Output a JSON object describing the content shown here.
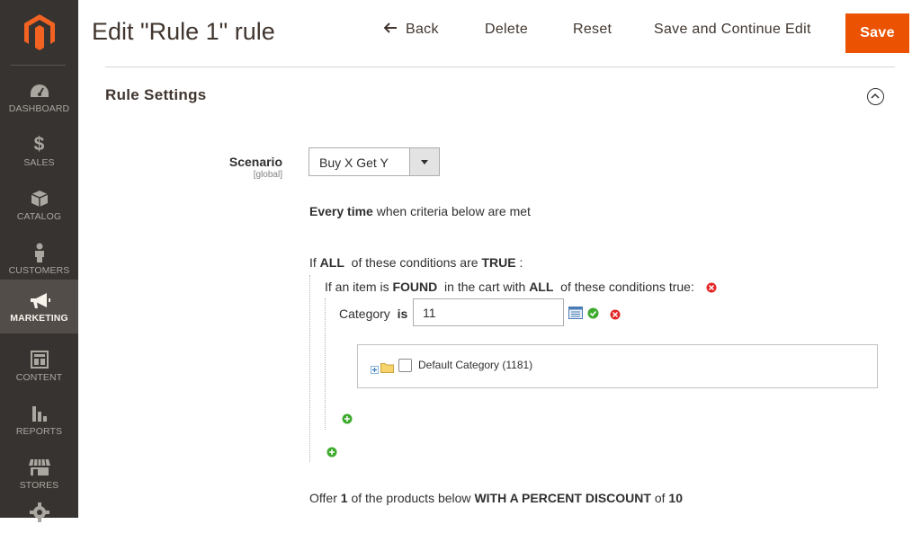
{
  "sidebar": {
    "items": [
      {
        "label": "DASHBOARD",
        "icon": "dashboard-icon"
      },
      {
        "label": "SALES",
        "icon": "dollar-icon"
      },
      {
        "label": "CATALOG",
        "icon": "cube-icon"
      },
      {
        "label": "CUSTOMERS",
        "icon": "person-icon"
      },
      {
        "label": "MARKETING",
        "icon": "megaphone-icon",
        "active": true
      },
      {
        "label": "CONTENT",
        "icon": "layout-icon"
      },
      {
        "label": "REPORTS",
        "icon": "bar-chart-icon"
      },
      {
        "label": "STORES",
        "icon": "store-icon"
      },
      {
        "label": "",
        "icon": "gear-icon"
      }
    ]
  },
  "header": {
    "title": "Edit \"Rule 1\" rule",
    "back_label": "Back",
    "delete_label": "Delete",
    "reset_label": "Reset",
    "save_continue_label": "Save and Continue Edit",
    "save_label": "Save"
  },
  "section": {
    "title": "Rule Settings"
  },
  "scenario": {
    "label": "Scenario",
    "scope": "[global]",
    "selected": "Buy X Get Y"
  },
  "rule": {
    "every_time_bold": "Every time",
    "every_time_rest": " when criteria below are met",
    "if_prefix": "If ",
    "if_all": "ALL",
    "if_mid": "  of these conditions are ",
    "if_true": "TRUE",
    "if_suffix": " :",
    "found_prefix": "If an item is ",
    "found_bold": "FOUND",
    "found_mid": "  in the cart with ",
    "found_all": "ALL",
    "found_suffix": "  of these conditions true:",
    "category_label": "Category",
    "category_op": "is",
    "category_value": "11",
    "tree_item": "Default Category (1181)",
    "offer_prefix": "Offer ",
    "offer_qty": "1",
    "offer_mid": " of the products below ",
    "offer_bold": "WITH A PERCENT DISCOUNT",
    "offer_of": " of ",
    "offer_value": "10"
  },
  "colors": {
    "sidebar_bg": "#373330",
    "sidebar_active": "#524d49",
    "accent": "#eb5202",
    "logo": "#f26322"
  }
}
